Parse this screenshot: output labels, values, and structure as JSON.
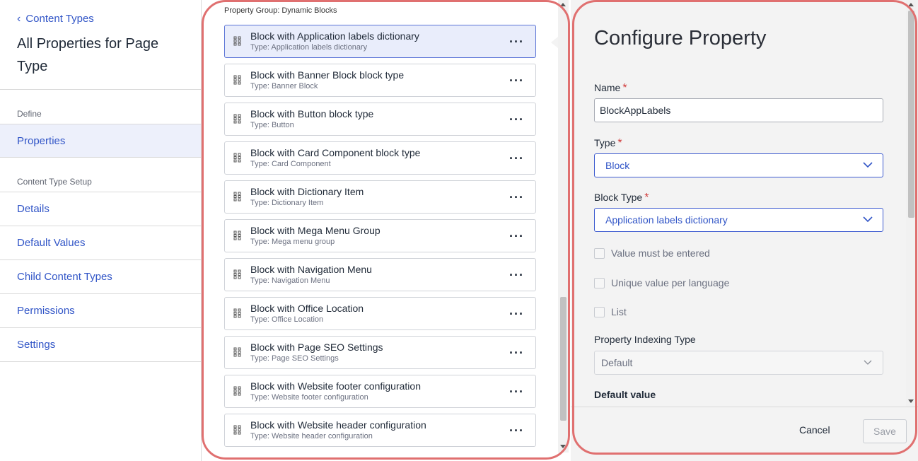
{
  "sidebar": {
    "back_label": "Content Types",
    "page_title": "All Properties for Page Type",
    "define_label": "Define",
    "properties_label": "Properties",
    "setup_label": "Content Type Setup",
    "nav": [
      {
        "label": "Details"
      },
      {
        "label": "Default Values"
      },
      {
        "label": "Child Content Types"
      },
      {
        "label": "Permissions"
      },
      {
        "label": "Settings"
      }
    ]
  },
  "middle": {
    "group_label": "Property Group: Dynamic Blocks",
    "items": [
      {
        "title": "Block with Application labels dictionary",
        "subtitle": "Type: Application labels dictionary",
        "selected": true
      },
      {
        "title": "Block with Banner Block block type",
        "subtitle": "Type: Banner Block",
        "selected": false
      },
      {
        "title": "Block with Button block type",
        "subtitle": "Type: Button",
        "selected": false
      },
      {
        "title": "Block with Card Component block type",
        "subtitle": "Type: Card Component",
        "selected": false
      },
      {
        "title": "Block with Dictionary Item",
        "subtitle": "Type: Dictionary Item",
        "selected": false
      },
      {
        "title": "Block with Mega Menu Group",
        "subtitle": "Type: Mega menu group",
        "selected": false
      },
      {
        "title": "Block with Navigation Menu",
        "subtitle": "Type: Navigation Menu",
        "selected": false
      },
      {
        "title": "Block with Office Location",
        "subtitle": "Type: Office Location",
        "selected": false
      },
      {
        "title": "Block with Page SEO Settings",
        "subtitle": "Type: Page SEO Settings",
        "selected": false
      },
      {
        "title": "Block with Website footer configuration",
        "subtitle": "Type: Website footer configuration",
        "selected": false
      },
      {
        "title": "Block with Website header configuration",
        "subtitle": "Type: Website header configuration",
        "selected": false
      }
    ],
    "more_icon": "ellipsis-icon",
    "grip_icon": "drag-handle-icon"
  },
  "configure": {
    "heading": "Configure Property",
    "name_label": "Name",
    "name_value": "BlockAppLabels",
    "type_label": "Type",
    "type_value": "Block",
    "block_type_label": "Block Type",
    "block_type_value": "Application labels dictionary",
    "required_mark": "*",
    "checkboxes": [
      {
        "label": "Value must be entered",
        "checked": false
      },
      {
        "label": "Unique value per language",
        "checked": false
      },
      {
        "label": "List",
        "checked": false
      }
    ],
    "indexing_label": "Property Indexing Type",
    "indexing_value": "Default",
    "default_value_label": "Default value",
    "cancel_label": "Cancel",
    "save_label": "Save"
  },
  "colors": {
    "accent": "#3155c7",
    "highlight": "#e07070",
    "required": "#d03a3a"
  }
}
